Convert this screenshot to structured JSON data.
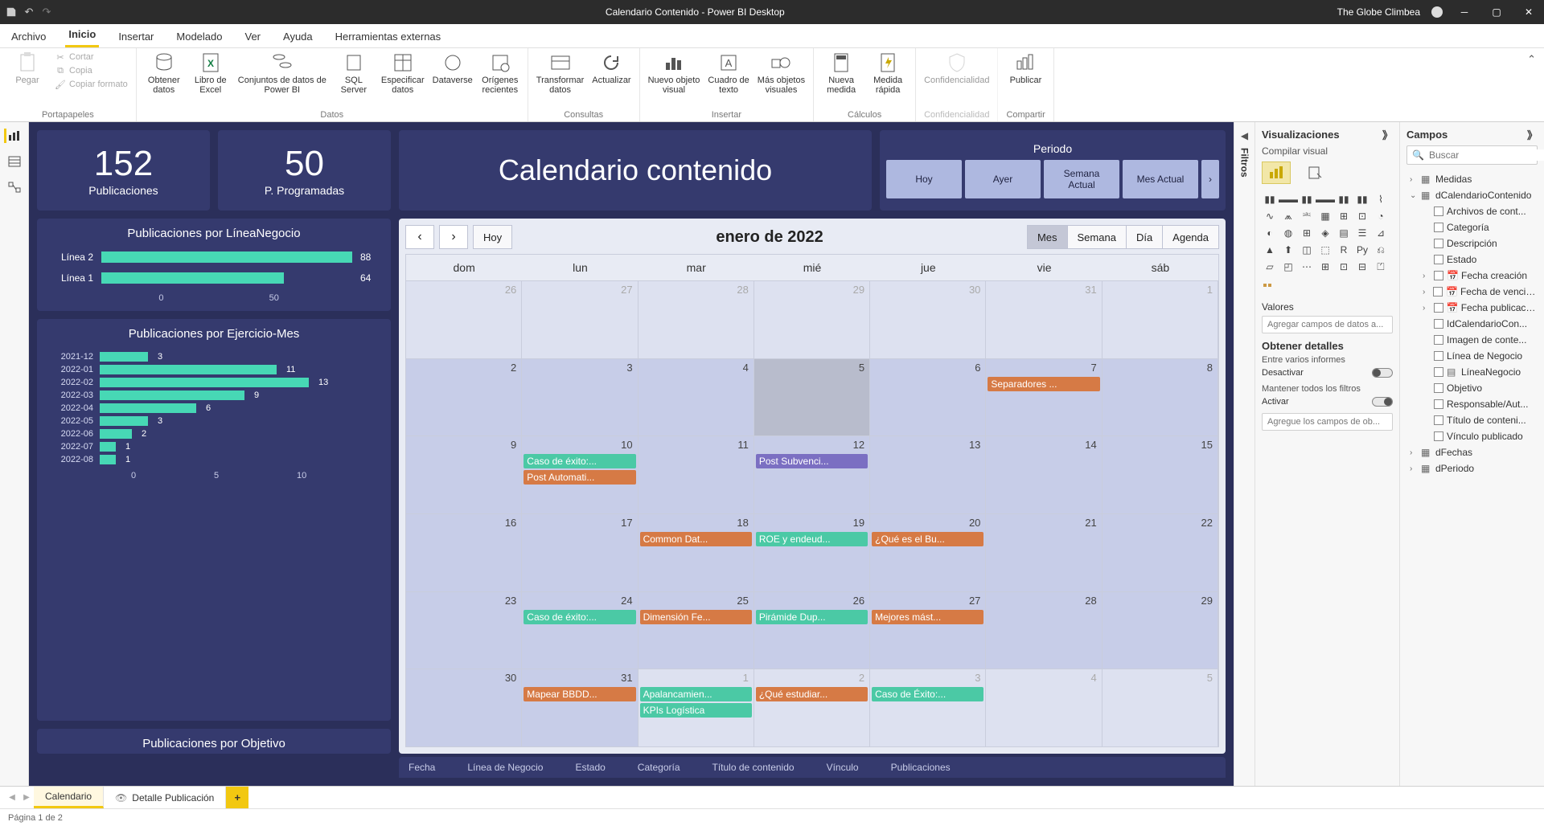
{
  "titlebar": {
    "title": "Calendario Contenido - Power BI Desktop",
    "user": "The Globe Climbea"
  },
  "menu": {
    "items": [
      "Archivo",
      "Inicio",
      "Insertar",
      "Modelado",
      "Ver",
      "Ayuda",
      "Herramientas externas"
    ],
    "active": 1
  },
  "ribbon": {
    "clipboard": {
      "label": "Portapapeles",
      "paste": "Pegar",
      "cut": "Cortar",
      "copy": "Copia",
      "format": "Copiar formato"
    },
    "data": {
      "label": "Datos",
      "get": "Obtener\ndatos",
      "excel": "Libro de\nExcel",
      "pbi": "Conjuntos de datos de\nPower BI",
      "sql": "SQL\nServer",
      "enter": "Especificar\ndatos",
      "dv": "Dataverse",
      "recent": "Orígenes\nrecientes"
    },
    "queries": {
      "label": "Consultas",
      "transform": "Transformar\ndatos",
      "refresh": "Actualizar"
    },
    "insert": {
      "label": "Insertar",
      "visual": "Nuevo objeto\nvisual",
      "textbox": "Cuadro de\ntexto",
      "more": "Más objetos\nvisuales"
    },
    "calc": {
      "label": "Cálculos",
      "measure": "Nueva\nmedida",
      "quick": "Medida\nrápida"
    },
    "conf": {
      "label": "Confidencialidad",
      "btn": "Confidencialidad"
    },
    "share": {
      "label": "Compartir",
      "publish": "Publicar"
    }
  },
  "periodo": {
    "label": "Periodo",
    "buttons": [
      "Hoy",
      "Ayer",
      "Semana\nActual",
      "Mes Actual"
    ]
  },
  "kpis": {
    "pub": {
      "value": "152",
      "label": "Publicaciones"
    },
    "prog": {
      "value": "50",
      "label": "P. Programadas"
    },
    "title": "Calendario contenido"
  },
  "chart_data": [
    {
      "type": "bar",
      "title": "Publicaciones por LíneaNegocio",
      "categories": [
        "Línea 2",
        "Línea 1"
      ],
      "values": [
        88,
        64
      ],
      "xticks": [
        "0",
        "50"
      ]
    },
    {
      "type": "bar",
      "title": "Publicaciones por Ejercicio-Mes",
      "categories": [
        "2021-12",
        "2022-01",
        "2022-02",
        "2022-03",
        "2022-04",
        "2022-05",
        "2022-06",
        "2022-07",
        "2022-08"
      ],
      "values": [
        3,
        11,
        13,
        9,
        6,
        3,
        2,
        1,
        1
      ],
      "xticks": [
        "0",
        "5",
        "10"
      ]
    },
    {
      "type": "bar",
      "title": "Publicaciones por Objetivo",
      "categories": [],
      "values": []
    }
  ],
  "calendar": {
    "hoy": "Hoy",
    "month": "enero de 2022",
    "views": [
      "Mes",
      "Semana",
      "Día",
      "Agenda"
    ],
    "active_view": 0,
    "dow": [
      "dom",
      "lun",
      "mar",
      "mié",
      "jue",
      "vie",
      "sáb"
    ],
    "weeks": [
      [
        {
          "n": "26",
          "o": true
        },
        {
          "n": "27",
          "o": true
        },
        {
          "n": "28",
          "o": true
        },
        {
          "n": "29",
          "o": true
        },
        {
          "n": "30",
          "o": true
        },
        {
          "n": "31",
          "o": true
        },
        {
          "n": "1",
          "o": true
        }
      ],
      [
        {
          "n": "2"
        },
        {
          "n": "3"
        },
        {
          "n": "4"
        },
        {
          "n": "5",
          "today": true
        },
        {
          "n": "6"
        },
        {
          "n": "7",
          "ev": [
            {
              "t": "Separadores ...",
              "c": "orange"
            }
          ]
        },
        {
          "n": "8"
        }
      ],
      [
        {
          "n": "9"
        },
        {
          "n": "10",
          "ev": [
            {
              "t": "Caso de éxito:...",
              "c": "teal"
            },
            {
              "t": "Post Automati...",
              "c": "orange"
            }
          ]
        },
        {
          "n": "11"
        },
        {
          "n": "12",
          "ev": [
            {
              "t": "Post Subvenci...",
              "c": "purple"
            }
          ]
        },
        {
          "n": "13"
        },
        {
          "n": "14"
        },
        {
          "n": "15"
        }
      ],
      [
        {
          "n": "16"
        },
        {
          "n": "17"
        },
        {
          "n": "18",
          "ev": [
            {
              "t": "Common Dat...",
              "c": "orange"
            }
          ]
        },
        {
          "n": "19",
          "ev": [
            {
              "t": "ROE y endeud...",
              "c": "teal"
            }
          ]
        },
        {
          "n": "20",
          "ev": [
            {
              "t": "¿Qué es el Bu...",
              "c": "orange"
            }
          ]
        },
        {
          "n": "21"
        },
        {
          "n": "22"
        }
      ],
      [
        {
          "n": "23"
        },
        {
          "n": "24",
          "ev": [
            {
              "t": "Caso de éxito:...",
              "c": "teal"
            }
          ]
        },
        {
          "n": "25",
          "ev": [
            {
              "t": "Dimensión Fe...",
              "c": "orange"
            }
          ]
        },
        {
          "n": "26",
          "ev": [
            {
              "t": "Pirámide Dup...",
              "c": "teal"
            }
          ]
        },
        {
          "n": "27",
          "ev": [
            {
              "t": "Mejores mást...",
              "c": "orange"
            }
          ]
        },
        {
          "n": "28"
        },
        {
          "n": "29"
        }
      ],
      [
        {
          "n": "30"
        },
        {
          "n": "31",
          "ev": [
            {
              "t": "Mapear BBDD...",
              "c": "orange"
            }
          ]
        },
        {
          "n": "1",
          "o": true,
          "ev": [
            {
              "t": "Apalancamien...",
              "c": "teal"
            },
            {
              "t": "KPIs Logística",
              "c": "teal"
            }
          ]
        },
        {
          "n": "2",
          "o": true,
          "ev": [
            {
              "t": "¿Qué estudiar...",
              "c": "orange"
            }
          ]
        },
        {
          "n": "3",
          "o": true,
          "ev": [
            {
              "t": "Caso de Éxito:...",
              "c": "teal"
            }
          ]
        },
        {
          "n": "4",
          "o": true
        },
        {
          "n": "5",
          "o": true
        }
      ]
    ]
  },
  "tablecols": [
    "Fecha",
    "Línea de Negocio",
    "Estado",
    "Categoría",
    "Título de contenido",
    "Vínculo",
    "Publicaciones"
  ],
  "viz": {
    "header": "Visualizaciones",
    "sub": "Compilar visual",
    "valores": "Valores",
    "valores_drop": "Agregar campos de datos a...",
    "detalles": "Obtener detalles",
    "crossreport": "Entre varios informes",
    "desactivar": "Desactivar",
    "keepall": "Mantener todos los filtros",
    "activar": "Activar",
    "obt_drop": "Agregue los campos de ob..."
  },
  "fields": {
    "header": "Campos",
    "search": "Buscar",
    "tables": {
      "medidas": "Medidas",
      "dcal": "dCalendarioContenido",
      "dfechas": "dFechas",
      "dperiodo": "dPeriodo"
    },
    "dcal_fields": [
      {
        "t": "Archivos de cont..."
      },
      {
        "t": "Categoría"
      },
      {
        "t": "Descripción"
      },
      {
        "t": "Estado"
      },
      {
        "t": "Fecha creación",
        "date": true,
        "exp": true
      },
      {
        "t": "Fecha de vencim...",
        "date": true,
        "exp": true
      },
      {
        "t": "Fecha publicación",
        "date": true,
        "exp": true
      },
      {
        "t": "IdCalendarioCon..."
      },
      {
        "t": "Imagen de conte..."
      },
      {
        "t": "Línea de Negocio"
      },
      {
        "t": "LíneaNegocio",
        "hier": true
      },
      {
        "t": "Objetivo"
      },
      {
        "t": "Responsable/Aut..."
      },
      {
        "t": "Título de conteni..."
      },
      {
        "t": "Vínculo publicado"
      }
    ]
  },
  "filtros": "Filtros",
  "pages": {
    "tabs": [
      "Calendario",
      "Detalle Publicación"
    ],
    "active": 0
  },
  "status": "Página 1 de 2"
}
